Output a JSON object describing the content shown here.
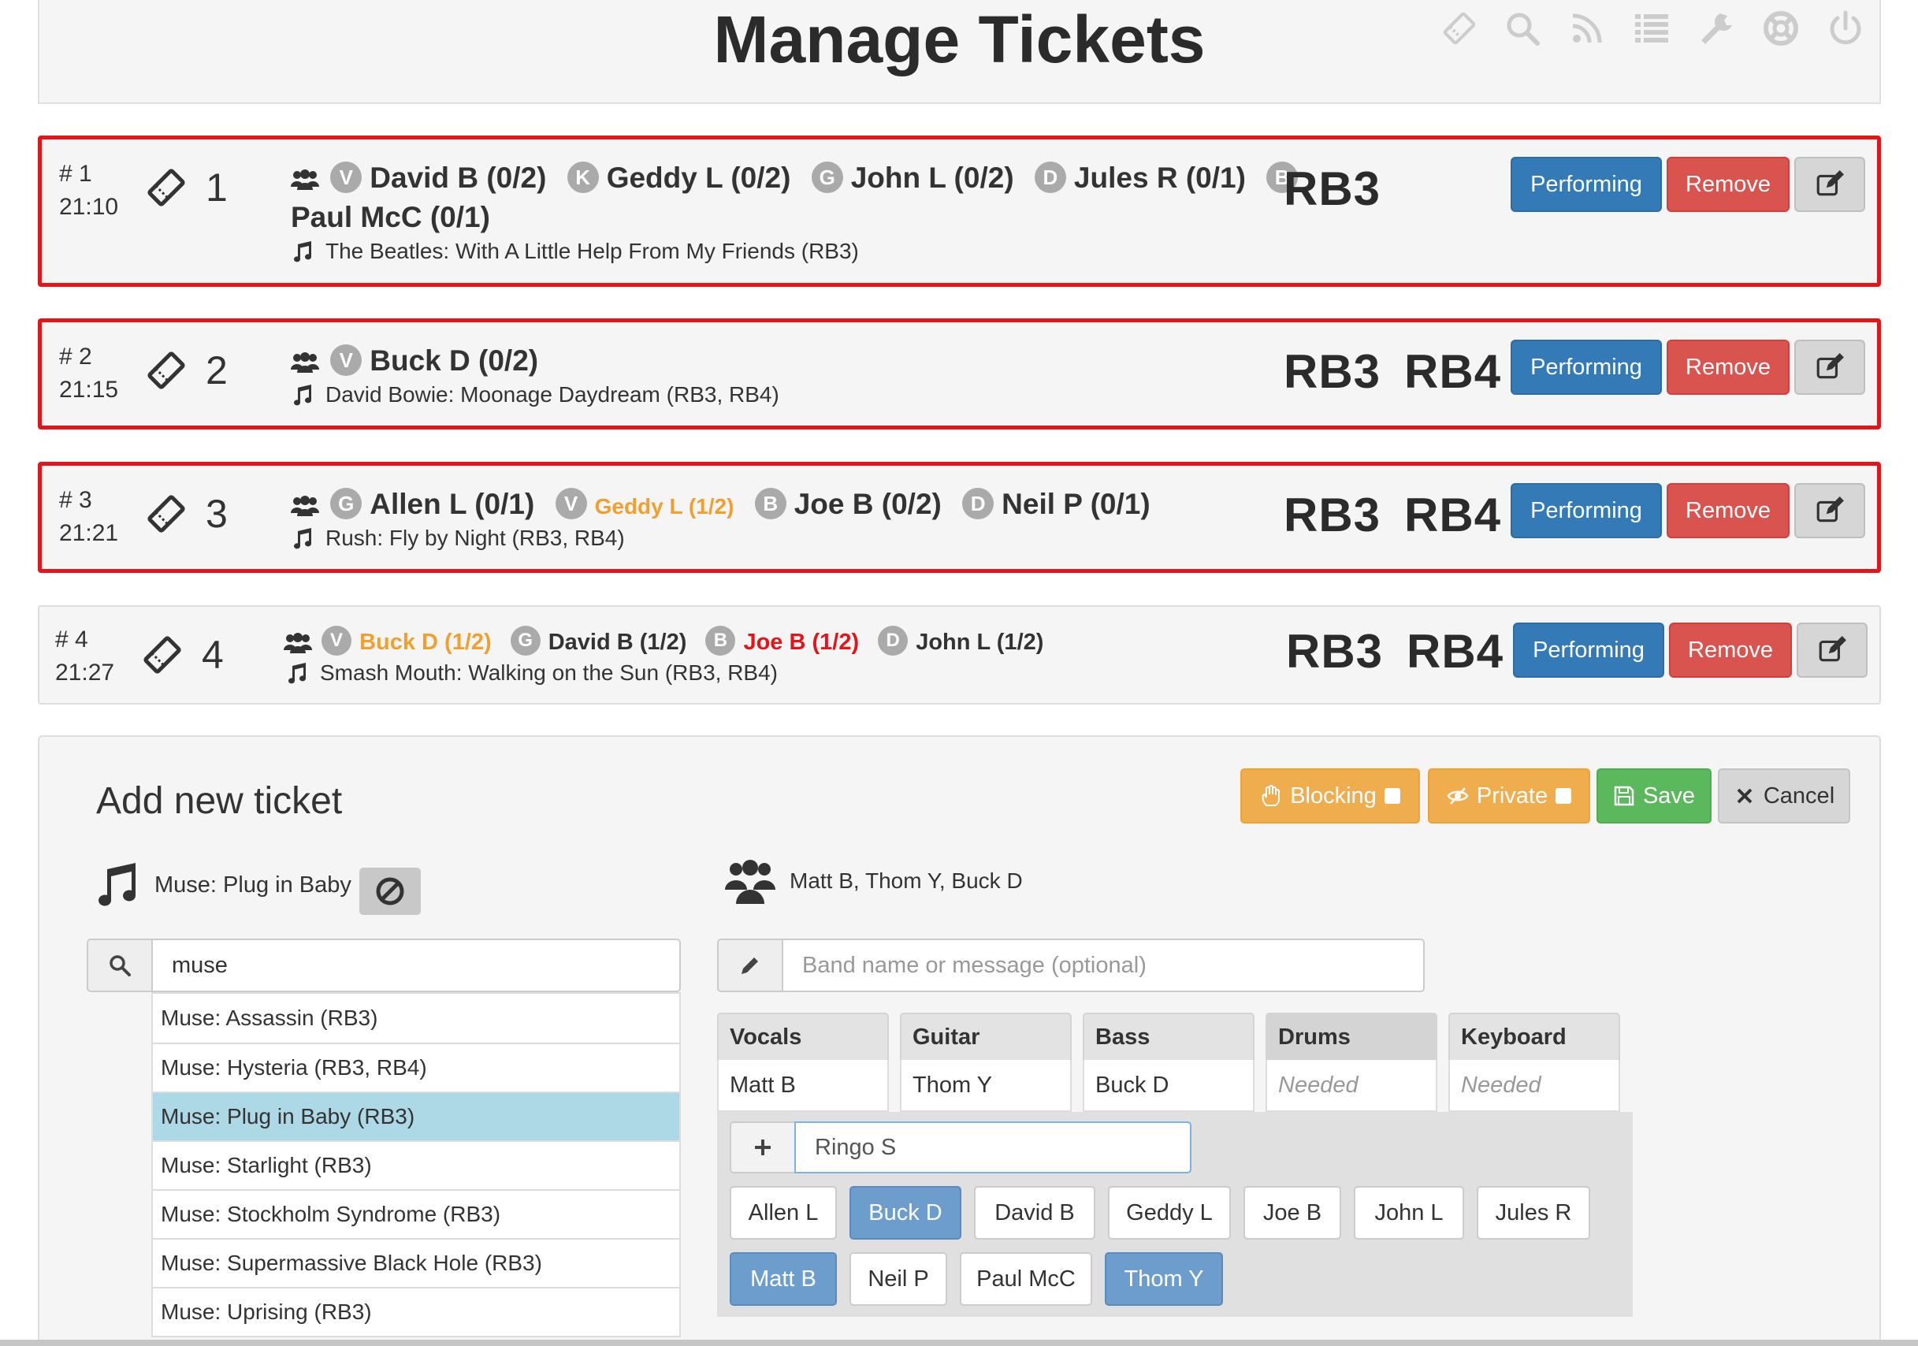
{
  "header": {
    "title": "Manage Tickets",
    "icons": [
      "ticket-icon",
      "search-icon",
      "rss-icon",
      "list-icon",
      "wrench-icon",
      "lifebuoy-icon",
      "power-icon"
    ]
  },
  "tickets": [
    {
      "number": "# 1",
      "time": "21:10",
      "ticket_no": "1",
      "performers": [
        {
          "instrument": "V",
          "name": "David B (0/2)"
        },
        {
          "instrument": "K",
          "name": "Geddy L (0/2)"
        },
        {
          "instrument": "G",
          "name": "John L (0/2)"
        },
        {
          "instrument": "D",
          "name": "Jules R (0/1)"
        },
        {
          "instrument": "B",
          "name": "Paul McC (0/1)"
        }
      ],
      "song": "The Beatles: With A Little Help From My Friends (RB3)",
      "tags": [
        "RB3"
      ],
      "buttons": {
        "performing": "Performing",
        "remove": "Remove"
      }
    },
    {
      "number": "# 2",
      "time": "21:15",
      "ticket_no": "2",
      "performers": [
        {
          "instrument": "V",
          "name": "Buck D (0/2)"
        }
      ],
      "song": "David Bowie: Moonage Daydream (RB3, RB4)",
      "tags": [
        "RB3",
        "RB4"
      ],
      "buttons": {
        "performing": "Performing",
        "remove": "Remove"
      }
    },
    {
      "number": "# 3",
      "time": "21:21",
      "ticket_no": "3",
      "performers": [
        {
          "instrument": "G",
          "name": "Allen L (0/1)"
        },
        {
          "instrument": "V",
          "name": "Geddy L (1/2)",
          "status": "warning"
        },
        {
          "instrument": "B",
          "name": "Joe B (0/2)"
        },
        {
          "instrument": "D",
          "name": "Neil P (0/1)"
        }
      ],
      "song": "Rush: Fly by Night (RB3, RB4)",
      "tags": [
        "RB3",
        "RB4"
      ],
      "buttons": {
        "performing": "Performing",
        "remove": "Remove"
      }
    },
    {
      "number": "# 4",
      "time": "21:27",
      "ticket_no": "4",
      "performers": [
        {
          "instrument": "V",
          "name": "Buck D (1/2)",
          "status": "warning"
        },
        {
          "instrument": "G",
          "name": "David B (1/2)"
        },
        {
          "instrument": "B",
          "name": "Joe B (1/2)",
          "status": "danger"
        },
        {
          "instrument": "D",
          "name": "John L (1/2)"
        }
      ],
      "song": "Smash Mouth: Walking on the Sun (RB3, RB4)",
      "tags": [
        "RB3",
        "RB4"
      ],
      "buttons": {
        "performing": "Performing",
        "remove": "Remove"
      }
    }
  ],
  "add_ticket": {
    "title": "Add new ticket",
    "buttons": {
      "blocking": "Blocking",
      "private": "Private",
      "save": "Save",
      "cancel": "Cancel"
    },
    "selected_song": "Muse: Plug in Baby",
    "song_search": {
      "value": "muse"
    },
    "song_results": [
      "Muse: Assassin (RB3)",
      "Muse: Hysteria (RB3, RB4)",
      "Muse: Plug in Baby (RB3)",
      "Muse: Starlight (RB3)",
      "Muse: Stockholm Syndrome (RB3)",
      "Muse: Supermassive Black Hole (RB3)",
      "Muse: Uprising (RB3)"
    ],
    "selected_result_index": 2,
    "band_summary": "Matt B, Thom Y, Buck D",
    "band_message": {
      "placeholder": "Band name or message (optional)"
    },
    "instruments": [
      {
        "label": "Vocals",
        "performer": "Matt B"
      },
      {
        "label": "Guitar",
        "performer": "Thom Y"
      },
      {
        "label": "Bass",
        "performer": "Buck D"
      },
      {
        "label": "Drums",
        "performer": "Needed",
        "active": true
      },
      {
        "label": "Keyboard",
        "performer": "Needed"
      }
    ],
    "performer_input": {
      "value": "Ringo S"
    },
    "performer_chips": [
      {
        "name": "Allen L",
        "selected": false
      },
      {
        "name": "Buck D",
        "selected": true
      },
      {
        "name": "David B",
        "selected": false
      },
      {
        "name": "Geddy L",
        "selected": false
      },
      {
        "name": "Joe B",
        "selected": false
      },
      {
        "name": "John L",
        "selected": false
      },
      {
        "name": "Jules R",
        "selected": false
      },
      {
        "name": "Matt B",
        "selected": true
      },
      {
        "name": "Neil P",
        "selected": false
      },
      {
        "name": "Paul McC",
        "selected": false
      },
      {
        "name": "Thom Y",
        "selected": true
      }
    ]
  },
  "colors": {
    "primary": "#337ab7",
    "danger": "#d9534f",
    "warning": "#f0ad4e",
    "success": "#5cb85c",
    "flag_border": "#e4141b",
    "warning_text": "#f0a030",
    "danger_text": "#e4141b",
    "selected_result": "#add8e6",
    "selected_chip": "#6d9dcc"
  }
}
